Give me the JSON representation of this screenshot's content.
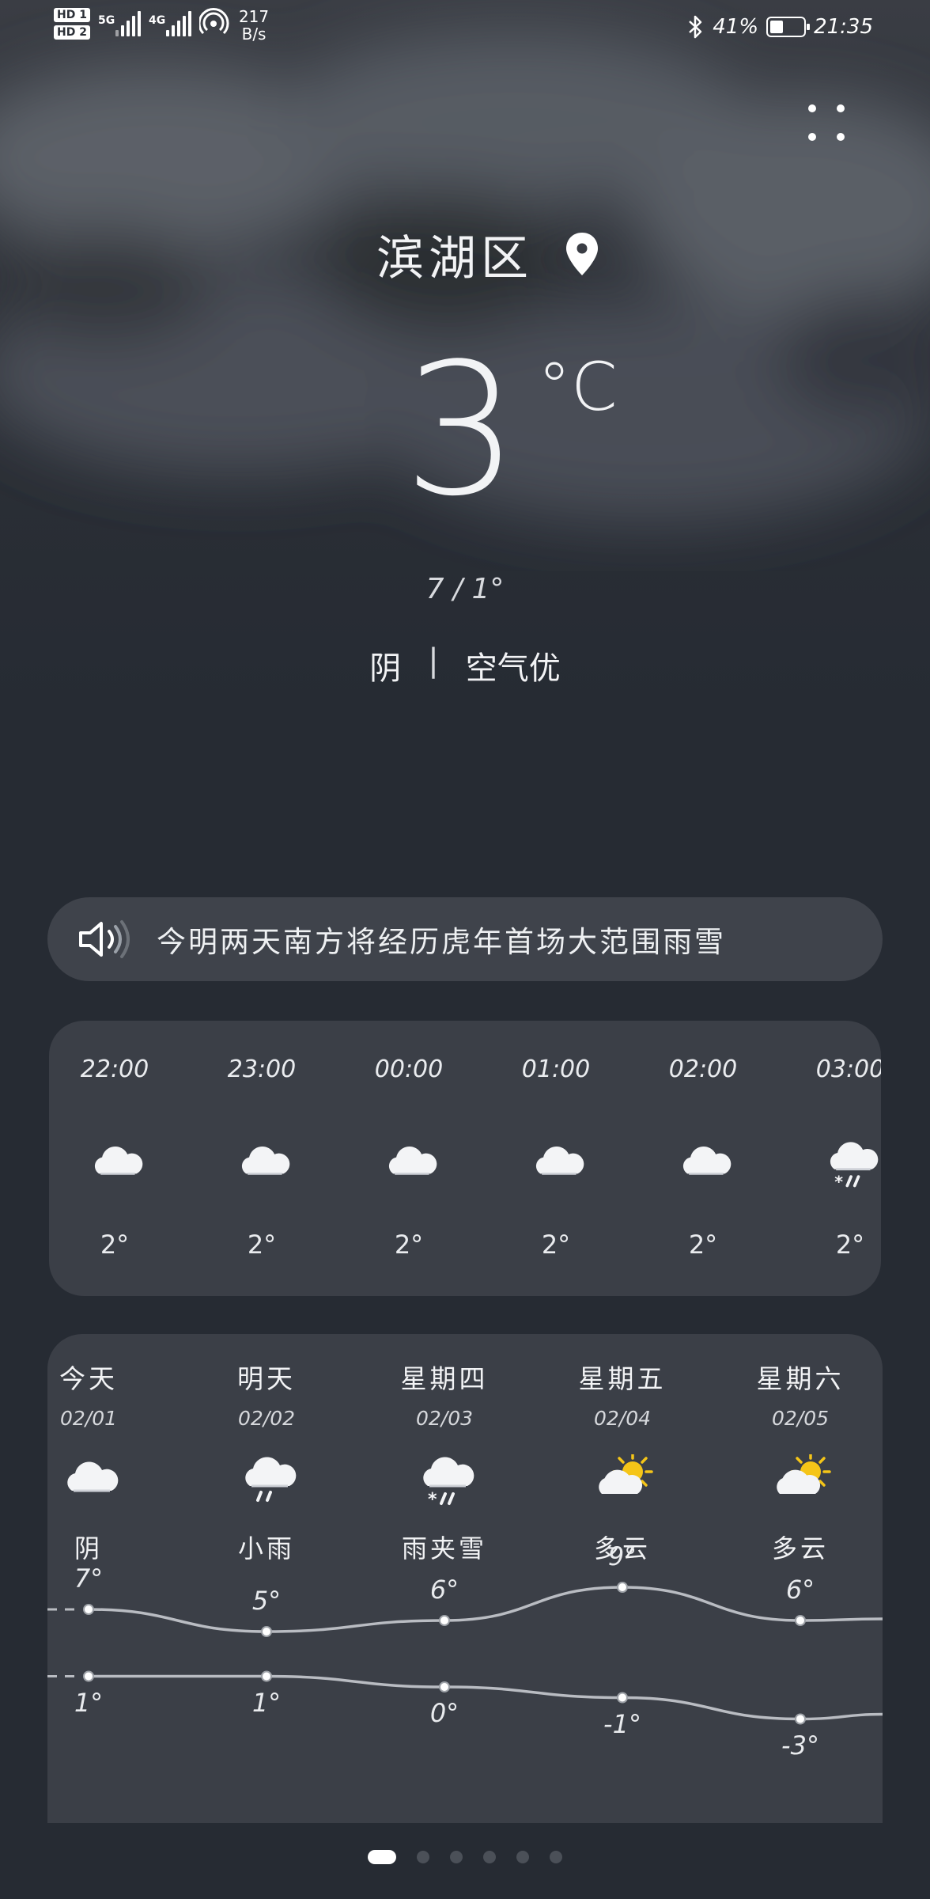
{
  "status_bar": {
    "sim1": "HD 1",
    "sim2": "HD 2",
    "net1": "5G",
    "net2": "4G",
    "speed_value": "217",
    "speed_unit": "B/s",
    "battery_text": "41%",
    "battery_level": 0.41,
    "time": "21:35"
  },
  "location": {
    "name": "滨湖区"
  },
  "current": {
    "temperature": "3",
    "unit": "°C",
    "high_low": "7 / 1°",
    "condition": "阴",
    "separator": "|",
    "air_quality": "空气优"
  },
  "news": {
    "headline": "今明两天南方将经历虎年首场大范围雨雪"
  },
  "hourly": [
    {
      "time": "22:00",
      "icon": "cloudy-icon",
      "temp": "2°"
    },
    {
      "time": "23:00",
      "icon": "cloudy-icon",
      "temp": "2°"
    },
    {
      "time": "00:00",
      "icon": "cloudy-icon",
      "temp": "2°"
    },
    {
      "time": "01:00",
      "icon": "cloudy-icon",
      "temp": "2°"
    },
    {
      "time": "02:00",
      "icon": "cloudy-icon",
      "temp": "2°"
    },
    {
      "time": "03:00",
      "icon": "sleet-icon",
      "temp": "2°"
    }
  ],
  "daily": [
    {
      "day": "今天",
      "date": "02/01",
      "icon": "cloudy-icon",
      "condition": "阴",
      "high": 7,
      "low": 1,
      "high_label": "7°",
      "low_label": "1°"
    },
    {
      "day": "明天",
      "date": "02/02",
      "icon": "light-rain-icon",
      "condition": "小雨",
      "high": 5,
      "low": 1,
      "high_label": "5°",
      "low_label": "1°"
    },
    {
      "day": "星期四",
      "date": "02/03",
      "icon": "sleet-icon",
      "condition": "雨夹雪",
      "high": 6,
      "low": 0,
      "high_label": "6°",
      "low_label": "0°"
    },
    {
      "day": "星期五",
      "date": "02/04",
      "icon": "partly-cloudy-icon",
      "condition": "多云",
      "high": 9,
      "low": -1,
      "high_label": "9°",
      "low_label": "-1°"
    },
    {
      "day": "星期六",
      "date": "02/05",
      "icon": "partly-cloudy-icon",
      "condition": "多云",
      "high": 6,
      "low": -3,
      "high_label": "6°",
      "low_label": "-3°"
    }
  ],
  "pager": {
    "count": 6,
    "active": 0
  },
  "colors": {
    "accent_sun": "#f5c518",
    "curve": "#b9bcc2",
    "card": "#3b3f47"
  }
}
